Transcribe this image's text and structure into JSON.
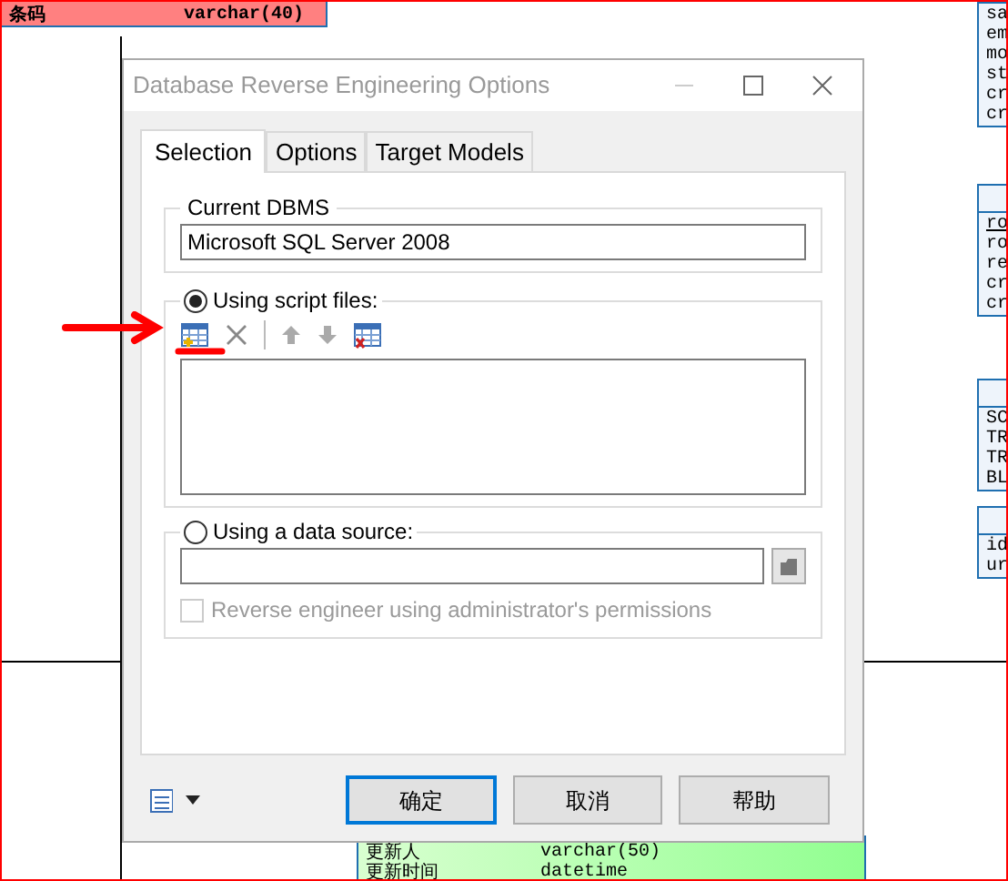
{
  "canvas": {
    "entities": [
      {
        "kind": "top",
        "rows": [
          {
            "name": "条码",
            "type": "varchar(40)"
          }
        ]
      },
      {
        "kind": "right1",
        "rows": [
          {
            "name": "sa"
          },
          {
            "name": "em"
          },
          {
            "name": "mo"
          },
          {
            "name": "st"
          },
          {
            "name": "cr"
          },
          {
            "name": "cr"
          }
        ]
      },
      {
        "kind": "right2",
        "rows": [
          {
            "name": "ro",
            "key": true
          },
          {
            "name": "ro"
          },
          {
            "name": "re"
          },
          {
            "name": "cr"
          },
          {
            "name": "cr"
          }
        ]
      },
      {
        "kind": "right3",
        "rows": [
          {
            "name": "SC"
          },
          {
            "name": "TR"
          },
          {
            "name": "TR"
          },
          {
            "name": "BL"
          }
        ]
      },
      {
        "kind": "right4",
        "rows": [
          {
            "name": "id"
          },
          {
            "name": "ur"
          }
        ]
      },
      {
        "kind": "bottom",
        "rows": [
          {
            "name": "更新人",
            "type": "varchar(50)"
          },
          {
            "name": "更新时间",
            "type": "datetime"
          }
        ]
      }
    ]
  },
  "dialog": {
    "title": "Database Reverse Engineering Options",
    "tabs": [
      {
        "label": "Selection",
        "selected": true
      },
      {
        "label": "Options",
        "selected": false
      },
      {
        "label": "Target Models",
        "selected": false
      }
    ],
    "dbms": {
      "legend": "Current DBMS",
      "value": "Microsoft SQL Server 2008"
    },
    "sources": [
      {
        "kind": "scripts",
        "label": "Using script files:",
        "selected": true
      },
      {
        "kind": "datasource",
        "label": "Using a data source:",
        "selected": false
      }
    ],
    "admin": {
      "label": "Reverse engineer using administrator's permissions",
      "checked": false,
      "disabled": true
    },
    "buttons": [
      {
        "label": "确定",
        "default": true
      },
      {
        "label": "取消",
        "default": false
      },
      {
        "label": "帮助",
        "default": false
      }
    ]
  }
}
